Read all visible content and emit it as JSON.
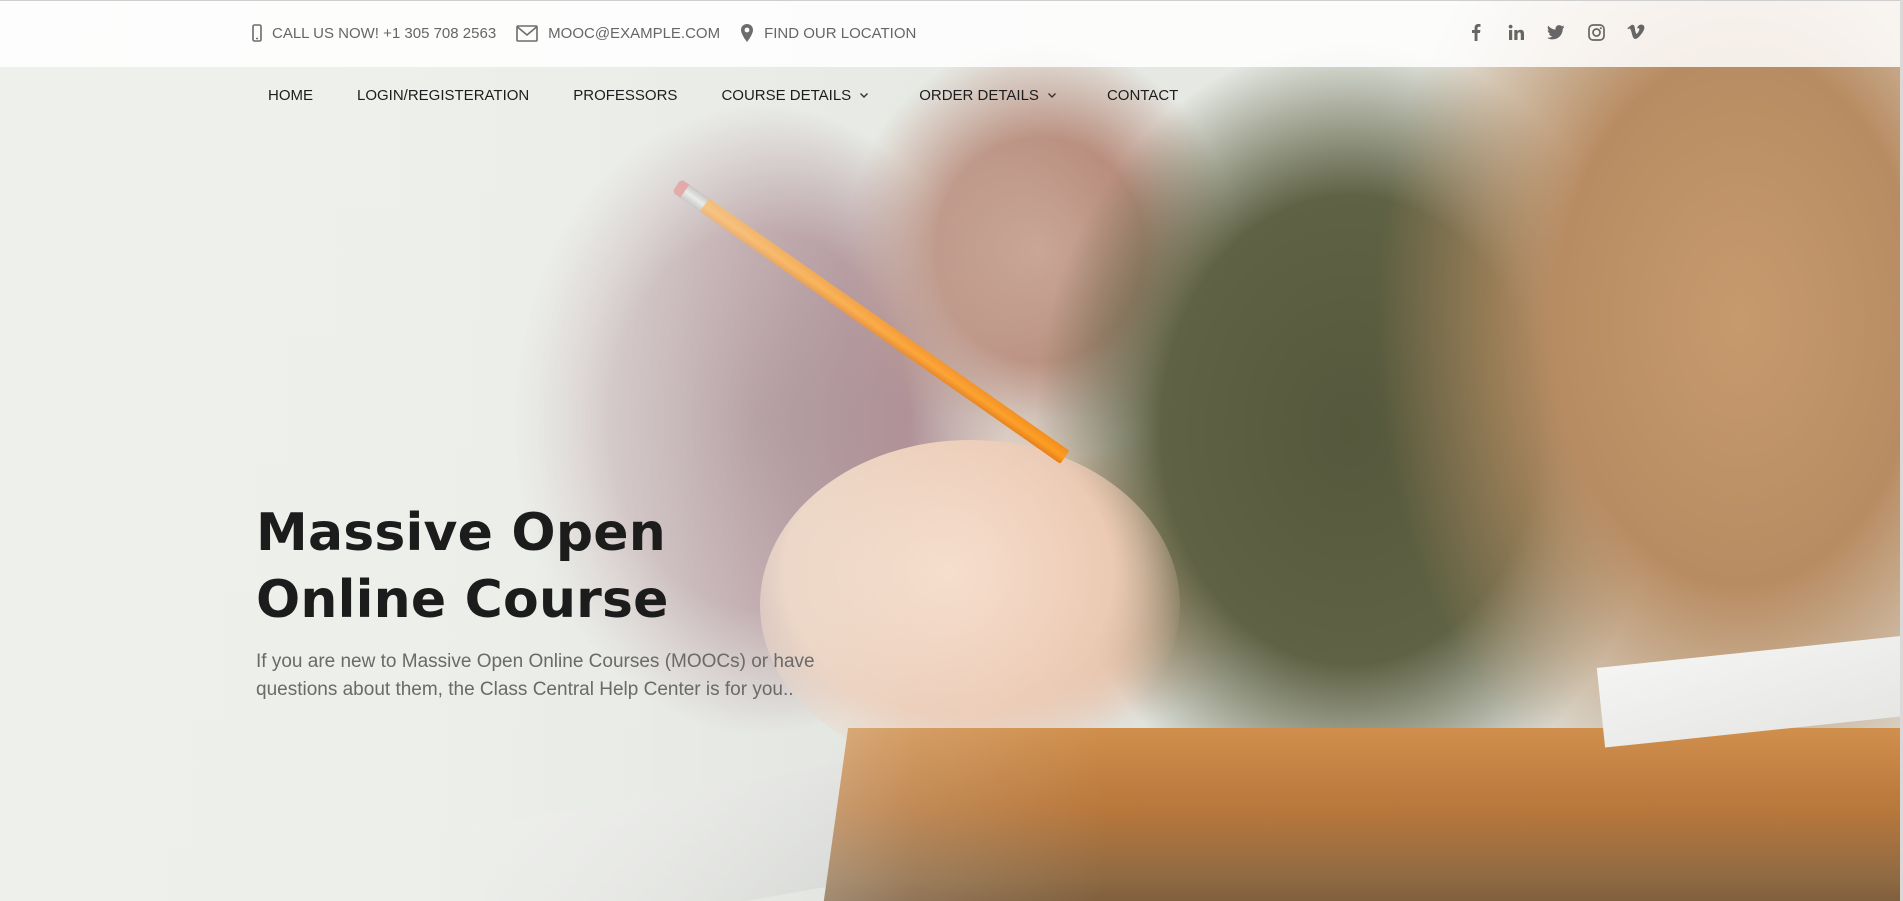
{
  "topbar": {
    "phone": "CALL US NOW! +1 305 708 2563",
    "email": "MOOC@EXAMPLE.COM",
    "location": "FIND OUR LOCATION",
    "icons": {
      "phone": "mobile-phone-icon",
      "email": "envelope-icon",
      "location": "map-pin-icon"
    },
    "social": [
      "facebook-icon",
      "linkedin-icon",
      "twitter-icon",
      "instagram-icon",
      "vimeo-icon"
    ]
  },
  "nav": {
    "home": "HOME",
    "login": "LOGIN/REGISTERATION",
    "professors": "PROFESSORS",
    "course_details": "COURSE DETAILS",
    "order_details": "ORDER DETAILS",
    "contact": "CONTACT"
  },
  "hero": {
    "title_line1": "Massive Open",
    "title_line2": "Online Course",
    "description": "If you are new to Massive Open Online Courses (MOOCs) or have questions about them, the Class Central Help Center is for you.."
  },
  "colors": {
    "text_dark": "#1d1d1d",
    "text_muted": "#666666",
    "pencil": "#ff9a1c"
  }
}
